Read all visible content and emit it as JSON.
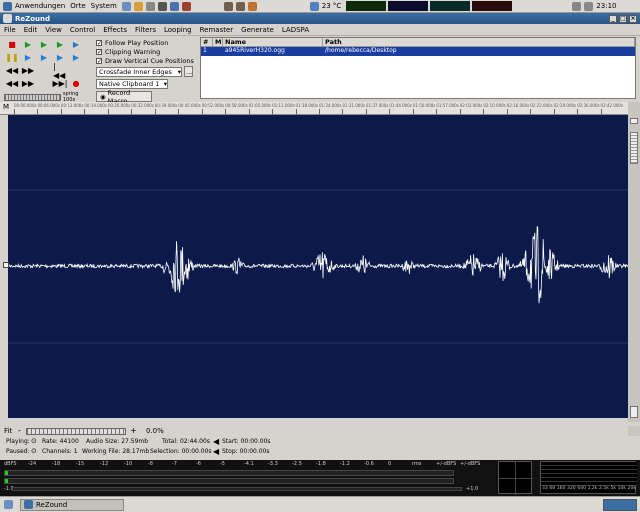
{
  "top_panel": {
    "menus": [
      "Anwendungen",
      "Orte",
      "System"
    ],
    "temperature": "23 °C",
    "clock": "23:10"
  },
  "window": {
    "title": "ReZound"
  },
  "menubar": [
    "File",
    "Edit",
    "View",
    "Control",
    "Effects",
    "Filters",
    "Looping",
    "Remaster",
    "Generate",
    "LADSPA"
  ],
  "options": {
    "follow_play_position": "Follow Play Position",
    "clipping_warning": "Clipping Warning",
    "draw_vertical_cue": "Draw Vertical Cue Positions",
    "crossfade": "Crossfade Inner Edges",
    "clipboard": "Native Clipboard 1",
    "record_macro": "Record Macro",
    "ellipsis": "..."
  },
  "shuttle": {
    "label_left": "1x",
    "label_right": "spring 100x"
  },
  "file_list": {
    "columns": [
      "#",
      "M",
      "Name",
      "Path"
    ],
    "rows": [
      {
        "num": "1",
        "m": "",
        "name": "a945RiverH320.ogg",
        "path": "/home/rebecca/Desktop"
      }
    ]
  },
  "ruler_marks": [
    "00:00.000s",
    "00:06.000s",
    "00:13.000s",
    "00:19.000s",
    "00:26.000s",
    "00:32.000s",
    "00:39.000s",
    "00:45.000s",
    "00:52.000s",
    "00:58.000s",
    "01:05.000s",
    "01:11.000s",
    "01:18.000s",
    "01:24.000s",
    "01:31.000s",
    "01:37.000s",
    "01:44.000s",
    "01:50.000s",
    "01:57.000s",
    "02:03.000s",
    "02:10.000s",
    "02:16.000s",
    "02:23.000s",
    "02:29.000s",
    "02:36.000s",
    "02:42.000s"
  ],
  "zoom": {
    "fit": "Fit",
    "minus": "-",
    "plus": "+",
    "percent": "0.0%"
  },
  "status": {
    "playing": "Playing:",
    "paused": "Paused:",
    "rate": "Rate: 44100",
    "channels": "Channels: 1",
    "audio_size": "Audio Size: 27.59mb",
    "working_file": "Working File: 28.17mb",
    "total": "Total: 02:44.00s",
    "selection": "Selection: 00:00.00s",
    "start": "Start: 00:00.00s",
    "stop": "Stop: 00:00.00s"
  },
  "meter_scale": [
    "dBFS",
    "-24",
    "-18",
    "-15",
    "-12",
    "-10",
    "-8",
    "-7",
    "-6",
    "-5",
    "-4.1",
    "-3.3",
    "-2.5",
    "-1.8",
    "-1.2",
    "-0.6",
    "0",
    "rms",
    "+/-dBFS",
    "+/-dBFS"
  ],
  "meter_ends": {
    "left": "-1.0",
    "right": "+1.0"
  },
  "analyzer_scale": [
    "33",
    "68",
    "160",
    "320",
    "640",
    "1.2k",
    "2.5k",
    "5k",
    "10k",
    "20k"
  ],
  "taskbar": {
    "window_label": "ReZound"
  },
  "colors": {
    "wave_bg": "#0b1a4a",
    "wave_line": "#ffffff",
    "selection": "#1a3ea0"
  }
}
